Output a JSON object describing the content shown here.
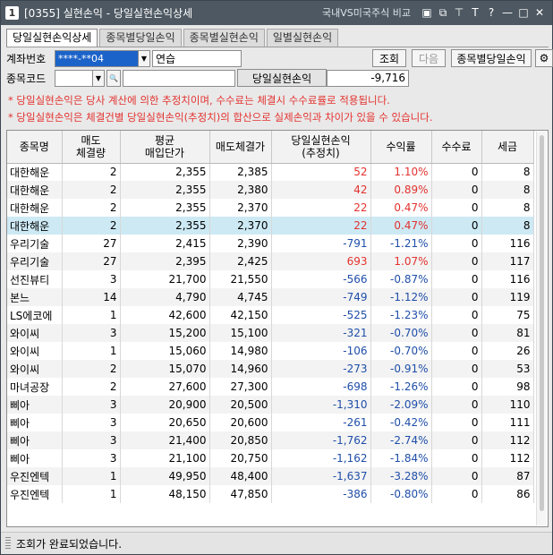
{
  "window": {
    "number": "1",
    "title": "[0355] 실현손익 - 당일실현손익상세",
    "link": "국내VS미국주식 비교",
    "icons": [
      "window-icon",
      "copy-icon",
      "pin-icon",
      "font-icon",
      "help-icon",
      "minimize-icon",
      "maximize-icon",
      "close-icon"
    ]
  },
  "tabs": [
    "당일실현손익상세",
    "종목별당일손익",
    "종목별실현손익",
    "일별실현손익"
  ],
  "form": {
    "account_label": "계좌번호",
    "account_value": "****-**04",
    "account_name": "연습",
    "query_button": "조회",
    "next_button": "다음",
    "by_stock_button": "종목별당일손익",
    "stock_code_label": "종목코드",
    "daily_pnl_label": "당일실현손익",
    "daily_pnl_value": "-9,716"
  },
  "notes": [
    "* 당일실현손익은 당사 계산에 의한 추정치이며, 수수료는 체결시 수수료률로 적용됩니다.",
    "* 당일실현손익은 체결건별 당일실현손익(추정치)의 합산으로 실제손익과 차이가 있을 수 있습니다."
  ],
  "table": {
    "headers": [
      [
        "종목명",
        ""
      ],
      [
        "매도",
        "체결량"
      ],
      [
        "평균",
        "매입단가"
      ],
      [
        "매도체결가",
        ""
      ],
      [
        "당일실현손익",
        "(추정치)"
      ],
      [
        "수익률",
        ""
      ],
      [
        "수수료",
        ""
      ],
      [
        "세금",
        ""
      ]
    ],
    "rows": [
      [
        "대한해운",
        "2",
        "2,355",
        "2,385",
        "52",
        "1.10%",
        "0",
        "8"
      ],
      [
        "대한해운",
        "2",
        "2,355",
        "2,380",
        "42",
        "0.89%",
        "0",
        "8"
      ],
      [
        "대한해운",
        "2",
        "2,355",
        "2,370",
        "22",
        "0.47%",
        "0",
        "8"
      ],
      [
        "대한해운",
        "2",
        "2,355",
        "2,370",
        "22",
        "0.47%",
        "0",
        "8"
      ],
      [
        "우리기술",
        "27",
        "2,415",
        "2,390",
        "-791",
        "-1.21%",
        "0",
        "116"
      ],
      [
        "우리기술",
        "27",
        "2,395",
        "2,425",
        "693",
        "1.07%",
        "0",
        "117"
      ],
      [
        "선진뷰티",
        "3",
        "21,700",
        "21,550",
        "-566",
        "-0.87%",
        "0",
        "116"
      ],
      [
        "본느",
        "14",
        "4,790",
        "4,745",
        "-749",
        "-1.12%",
        "0",
        "119"
      ],
      [
        "LS에코에",
        "1",
        "42,600",
        "42,150",
        "-525",
        "-1.23%",
        "0",
        "75"
      ],
      [
        "와이씨",
        "3",
        "15,200",
        "15,100",
        "-321",
        "-0.70%",
        "0",
        "81"
      ],
      [
        "와이씨",
        "1",
        "15,060",
        "14,980",
        "-106",
        "-0.70%",
        "0",
        "26"
      ],
      [
        "와이씨",
        "2",
        "15,070",
        "14,960",
        "-273",
        "-0.91%",
        "0",
        "53"
      ],
      [
        "마녀공장",
        "2",
        "27,600",
        "27,300",
        "-698",
        "-1.26%",
        "0",
        "98"
      ],
      [
        "삐아",
        "3",
        "20,900",
        "20,500",
        "-1,310",
        "-2.09%",
        "0",
        "110"
      ],
      [
        "삐아",
        "3",
        "20,650",
        "20,600",
        "-261",
        "-0.42%",
        "0",
        "111"
      ],
      [
        "삐아",
        "3",
        "21,400",
        "20,850",
        "-1,762",
        "-2.74%",
        "0",
        "112"
      ],
      [
        "삐아",
        "3",
        "21,100",
        "20,750",
        "-1,162",
        "-1.84%",
        "0",
        "112"
      ],
      [
        "우진엔텍",
        "1",
        "49,950",
        "48,400",
        "-1,637",
        "-3.28%",
        "0",
        "87"
      ],
      [
        "우진엔텍",
        "1",
        "48,150",
        "47,850",
        "-386",
        "-0.80%",
        "0",
        "86"
      ]
    ],
    "selected_row": 3
  },
  "status": "조회가 완료되었습니다.",
  "colors": {
    "positive": "#e3322f",
    "negative": "#1f4ea8",
    "selected": "#cde9f4",
    "titlebar": "#4d5862"
  }
}
